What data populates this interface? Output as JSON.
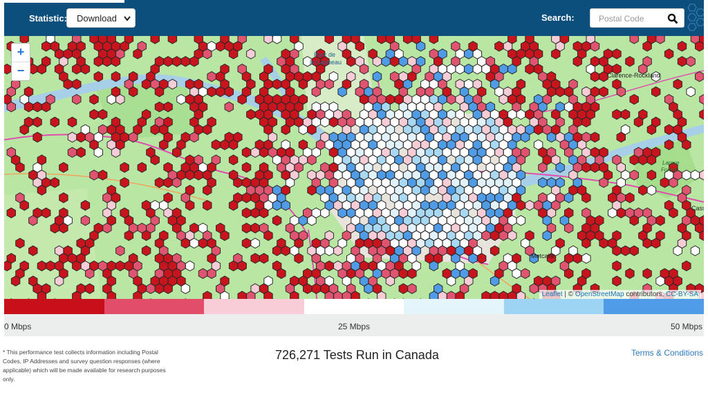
{
  "header": {
    "statistic_label": "Statistic:",
    "statistic_selected": "Download",
    "search_label": "Search:",
    "search_placeholder": "Postal Code"
  },
  "map": {
    "zoom_in": "+",
    "zoom_out": "−",
    "place_labels": [
      {
        "id": "parc",
        "text": "Parc de\nla Gatineau"
      },
      {
        "id": "clarence",
        "text": "Clarence-Rockland"
      },
      {
        "id": "larose",
        "text": "Larose\nForest"
      },
      {
        "id": "metcalfe",
        "text": "Metcalfe"
      },
      {
        "id": "cass",
        "text": "Cass"
      }
    ],
    "attribution": {
      "leaflet": "Leaflet",
      "copy": "| ©",
      "osm": "OpenStreetMap",
      "contrib": "contributors,",
      "license": "CC-BY-SA"
    },
    "hex_colors": {
      "red": "#c8141c",
      "pink": "#e05470",
      "lightpink": "#f6cdd7",
      "white": "#ffffff",
      "lightblue": "#e1f2fa",
      "skyblue": "#a9d8f2",
      "blue": "#4f9be6"
    }
  },
  "legend": {
    "colors": [
      "#c8101a",
      "#e24d6a",
      "#f8cdd8",
      "#ffffff",
      "#e4f4fb",
      "#9dd4f3",
      "#4f9be8"
    ],
    "label_min": "0 Mbps",
    "label_mid": "25 Mbps",
    "label_max": "50 Mbps"
  },
  "footer": {
    "note": "* This performance test collects information including Postal Codes, IP Addresses and survey question responses (where applicable) which will be made available for research purposes only.",
    "tests_run": "726,271 Tests Run in Canada",
    "terms": "Terms & Conditions"
  }
}
